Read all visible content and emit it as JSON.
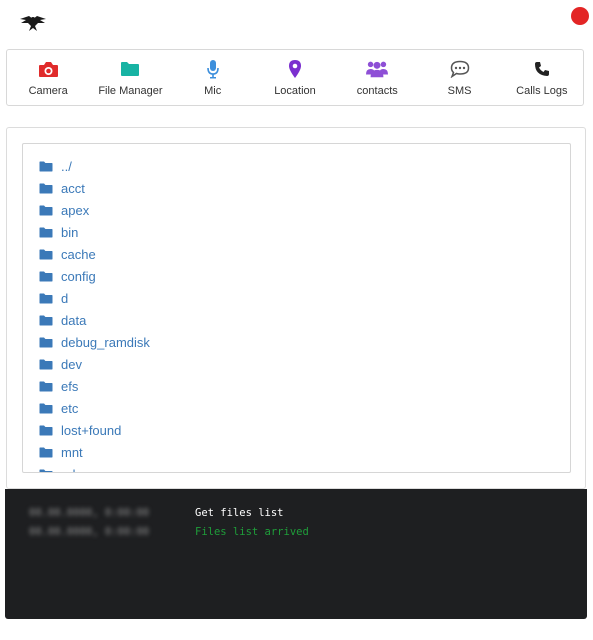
{
  "toolbar": {
    "items": [
      {
        "label": "Camera",
        "icon": "camera-icon",
        "color": "#e02b2b"
      },
      {
        "label": "File Manager",
        "icon": "folder-icon",
        "color": "#17b3a3"
      },
      {
        "label": "Mic",
        "icon": "mic-icon",
        "color": "#3d8fdc"
      },
      {
        "label": "Location",
        "icon": "map-pin-icon",
        "color": "#7b2fcf"
      },
      {
        "label": "contacts",
        "icon": "users-icon",
        "color": "#8e4fd6"
      },
      {
        "label": "SMS",
        "icon": "sms-icon",
        "color": "#555555"
      },
      {
        "label": "Calls Logs",
        "icon": "phone-icon",
        "color": "#222222"
      }
    ]
  },
  "status": {
    "color": "#e32525"
  },
  "file_manager": {
    "folder_color": "#3b79b8",
    "entries": [
      "../",
      "acct",
      "apex",
      "bin",
      "cache",
      "config",
      "d",
      "data",
      "debug_ramdisk",
      "dev",
      "efs",
      "etc",
      "lost+found",
      "mnt",
      "odm"
    ]
  },
  "console": {
    "lines": [
      {
        "time": "00.00.0000, 0:00:00",
        "message": "Get files list",
        "color": "#ffffff"
      },
      {
        "time": "00.00.0000, 0:00:00",
        "message": "Files list arrived",
        "color": "#1f9e3a"
      }
    ]
  }
}
